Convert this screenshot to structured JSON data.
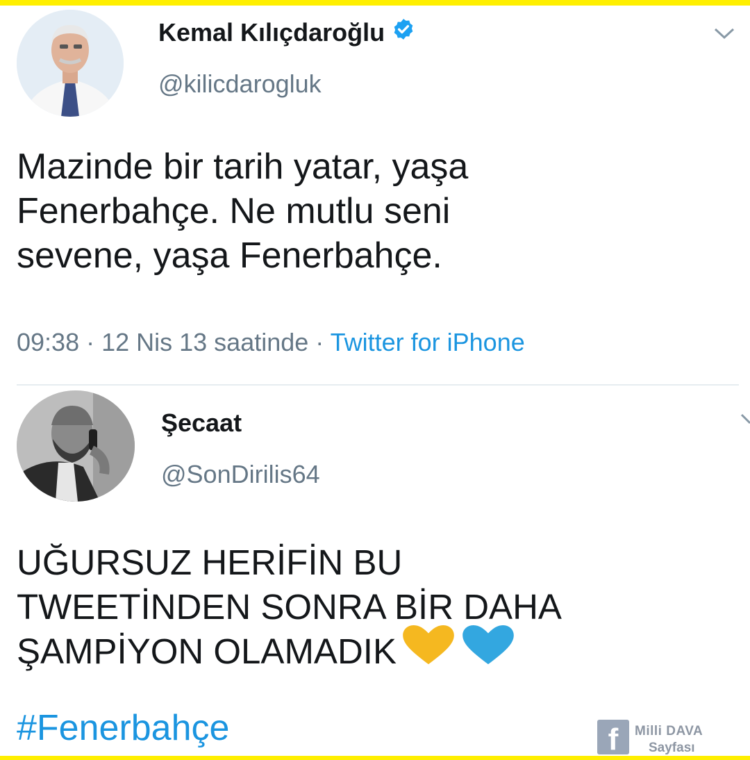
{
  "tweets": [
    {
      "name": "Kemal Kılıçdaroğlu",
      "handle": "@kilicdarogluk",
      "verified": true,
      "text": "Mazinde bir tarih yatar, yaşa\nFenerbahçe. Ne mutlu seni\nsevene, yaşa Fenerbahçe.",
      "timestamp": "09:38 · 12 Nis 13 saatinde · ",
      "source": "Twitter for iPhone"
    },
    {
      "name": "Şecaat",
      "handle": "@SonDirilis64",
      "verified": false,
      "text": "UĞURSUZ HERİFİN BU\nTWEETİNDEN SONRA BİR DAHA\nŞAMPİYON OLAMADIK",
      "hashtag": "#Fenerbahçe",
      "hearts": [
        "yellow-heart-icon",
        "blue-heart-icon"
      ]
    }
  ],
  "watermark": {
    "logo_letter": "f",
    "line1": "Milli DAVA",
    "line2": "Sayfası"
  },
  "colors": {
    "border": "#ffef00",
    "link": "#1b95e0",
    "muted": "#657786",
    "verified": "#1da1f2",
    "yellow_heart": "#f5b820",
    "blue_heart": "#33a7e0"
  }
}
